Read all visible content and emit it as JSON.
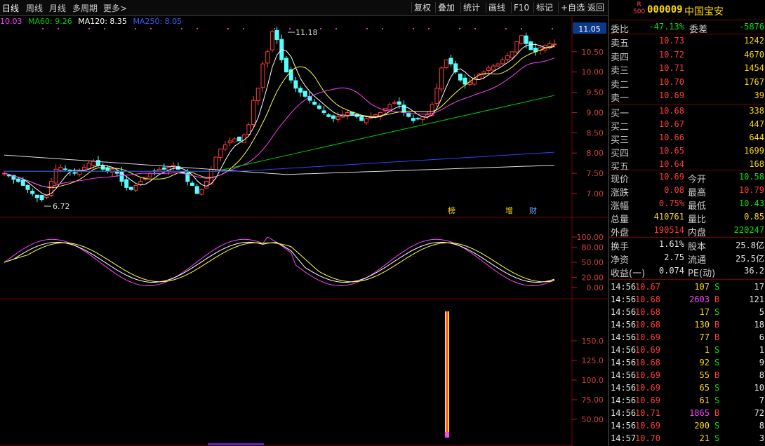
{
  "toolbar": {
    "periods": [
      "日线",
      "周线",
      "月线",
      "多周期",
      "更多>"
    ],
    "buttons": [
      "复权",
      "叠加",
      "统计",
      "画线",
      "F10",
      "标记",
      "+自选",
      "返回"
    ]
  },
  "ma": {
    "current": "10.03",
    "ma60": "MA60: 9.26",
    "ma120": "MA120: 8.35",
    "ma250": "MA250: 8.05"
  },
  "price_chart": {
    "price_labels": [
      "11.05",
      "10.50",
      "10.00",
      "9.50",
      "9.00",
      "8.50",
      "8.00",
      "7.50",
      "7.00"
    ],
    "price_values": [
      11.05,
      10.5,
      10.0,
      9.5,
      9.0,
      8.5,
      8.0,
      7.5,
      7.0
    ],
    "high_label": "11.18",
    "low_label": "6.72",
    "markers": [
      "榜",
      "增",
      "财"
    ]
  },
  "osc_chart": {
    "labels": [
      "100.00",
      "80.00",
      "50.00",
      "20.00",
      "0.00"
    ]
  },
  "vol_chart": {
    "labels": [
      "150.0",
      "125.0",
      "100.0",
      "75.00",
      "50.00"
    ]
  },
  "colors": {
    "bg": "#000000",
    "up": "#ff3c3c",
    "down": "#54ffff",
    "ma5": "#ffffff",
    "ma10": "#ffff40",
    "ma20": "#ff40ff",
    "ma60": "#00d000",
    "ma120": "#ffffff",
    "ma250": "#3040ff",
    "grid": "#7a0000"
  },
  "stock": {
    "badge_top": "R",
    "badge_bottom": "500",
    "code": "000009",
    "name": "中国宝安"
  },
  "wei": {
    "label1": "委比",
    "value1": "-47.13%",
    "label2": "委差",
    "value2": "-5876"
  },
  "sell": [
    {
      "label": "卖五",
      "price": "10.73",
      "vol": "1242"
    },
    {
      "label": "卖四",
      "price": "10.72",
      "vol": "4670"
    },
    {
      "label": "卖三",
      "price": "10.71",
      "vol": "1454"
    },
    {
      "label": "卖二",
      "price": "10.70",
      "vol": "1767"
    },
    {
      "label": "卖一",
      "price": "10.69",
      "vol": "39"
    }
  ],
  "buy": [
    {
      "label": "买一",
      "price": "10.68",
      "vol": "338"
    },
    {
      "label": "买二",
      "price": "10.67",
      "vol": "447"
    },
    {
      "label": "买三",
      "price": "10.66",
      "vol": "644"
    },
    {
      "label": "买四",
      "price": "10.65",
      "vol": "1699"
    },
    {
      "label": "买五",
      "price": "10.64",
      "vol": "168"
    }
  ],
  "quote": [
    {
      "l1": "现价",
      "v1": "10.69",
      "c1": "red",
      "l2": "今开",
      "v2": "10.58",
      "c2": "green"
    },
    {
      "l1": "涨跌",
      "v1": "0.08",
      "c1": "red",
      "l2": "最高",
      "v2": "10.79",
      "c2": "red"
    },
    {
      "l1": "涨幅",
      "v1": "0.75%",
      "c1": "red",
      "l2": "最低",
      "v2": "10.43",
      "c2": "green"
    },
    {
      "l1": "总量",
      "v1": "410761",
      "c1": "yellow",
      "l2": "量比",
      "v2": "0.85",
      "c2": "yellow"
    },
    {
      "l1": "外盘",
      "v1": "190514",
      "c1": "red",
      "l2": "内盘",
      "v2": "220247",
      "c2": "green"
    }
  ],
  "finance": [
    {
      "l1": "换手",
      "v1": "1.61%",
      "l2": "股本",
      "v2": "25.8亿"
    },
    {
      "l1": "净资",
      "v1": "2.75",
      "l2": "流通",
      "v2": "25.5亿"
    },
    {
      "l1": "收益(一)",
      "v1": "0.074",
      "l2": "PE(动)",
      "v2": "36.2"
    }
  ],
  "ticks": [
    {
      "time": "14:56",
      "price": "10.67",
      "vol": "107",
      "side": "S",
      "n": "17"
    },
    {
      "time": "14:56",
      "price": "10.68",
      "vol": "2603",
      "side": "B",
      "n": "121"
    },
    {
      "time": "14:56",
      "price": "10.68",
      "vol": "17",
      "side": "S",
      "n": "5"
    },
    {
      "time": "14:56",
      "price": "10.68",
      "vol": "130",
      "side": "B",
      "n": "18"
    },
    {
      "time": "14:56",
      "price": "10.69",
      "vol": "77",
      "side": "B",
      "n": "6"
    },
    {
      "time": "14:56",
      "price": "10.69",
      "vol": "1",
      "side": "S",
      "n": "1"
    },
    {
      "time": "14:56",
      "price": "10.68",
      "vol": "92",
      "side": "S",
      "n": "9"
    },
    {
      "time": "14:56",
      "price": "10.69",
      "vol": "55",
      "side": "B",
      "n": "8"
    },
    {
      "time": "14:56",
      "price": "10.69",
      "vol": "65",
      "side": "S",
      "n": "10"
    },
    {
      "time": "14:56",
      "price": "10.69",
      "vol": "61",
      "side": "S",
      "n": "7"
    },
    {
      "time": "14:56",
      "price": "10.71",
      "vol": "1865",
      "side": "B",
      "n": "72"
    },
    {
      "time": "14:56",
      "price": "10.69",
      "vol": "200",
      "side": "S",
      "n": "8"
    },
    {
      "time": "14:57",
      "price": "10.70",
      "vol": "21",
      "side": "S",
      "n": "3"
    }
  ]
}
